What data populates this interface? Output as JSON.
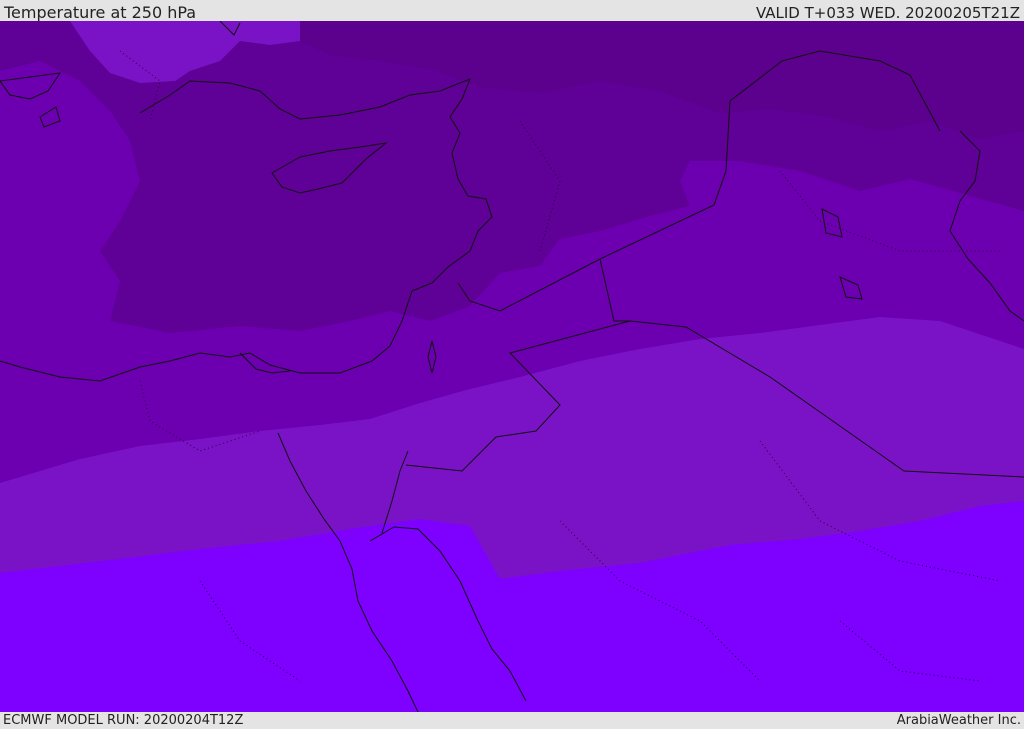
{
  "header": {
    "title": "Temperature at 250 hPa",
    "valid": "VALID T+033 WED. 20200205T21Z"
  },
  "footer": {
    "model_run": "ECMWF MODEL RUN: 20200204T12Z",
    "credit": "ArabiaWeather Inc."
  },
  "map": {
    "variable": "temperature",
    "level": "250 hPa",
    "shading_colors": [
      "#5f0096",
      "#6c00b0",
      "#7a12c6",
      "#7d00ea",
      "#7e00fe"
    ],
    "boundary_color": "#111111"
  }
}
